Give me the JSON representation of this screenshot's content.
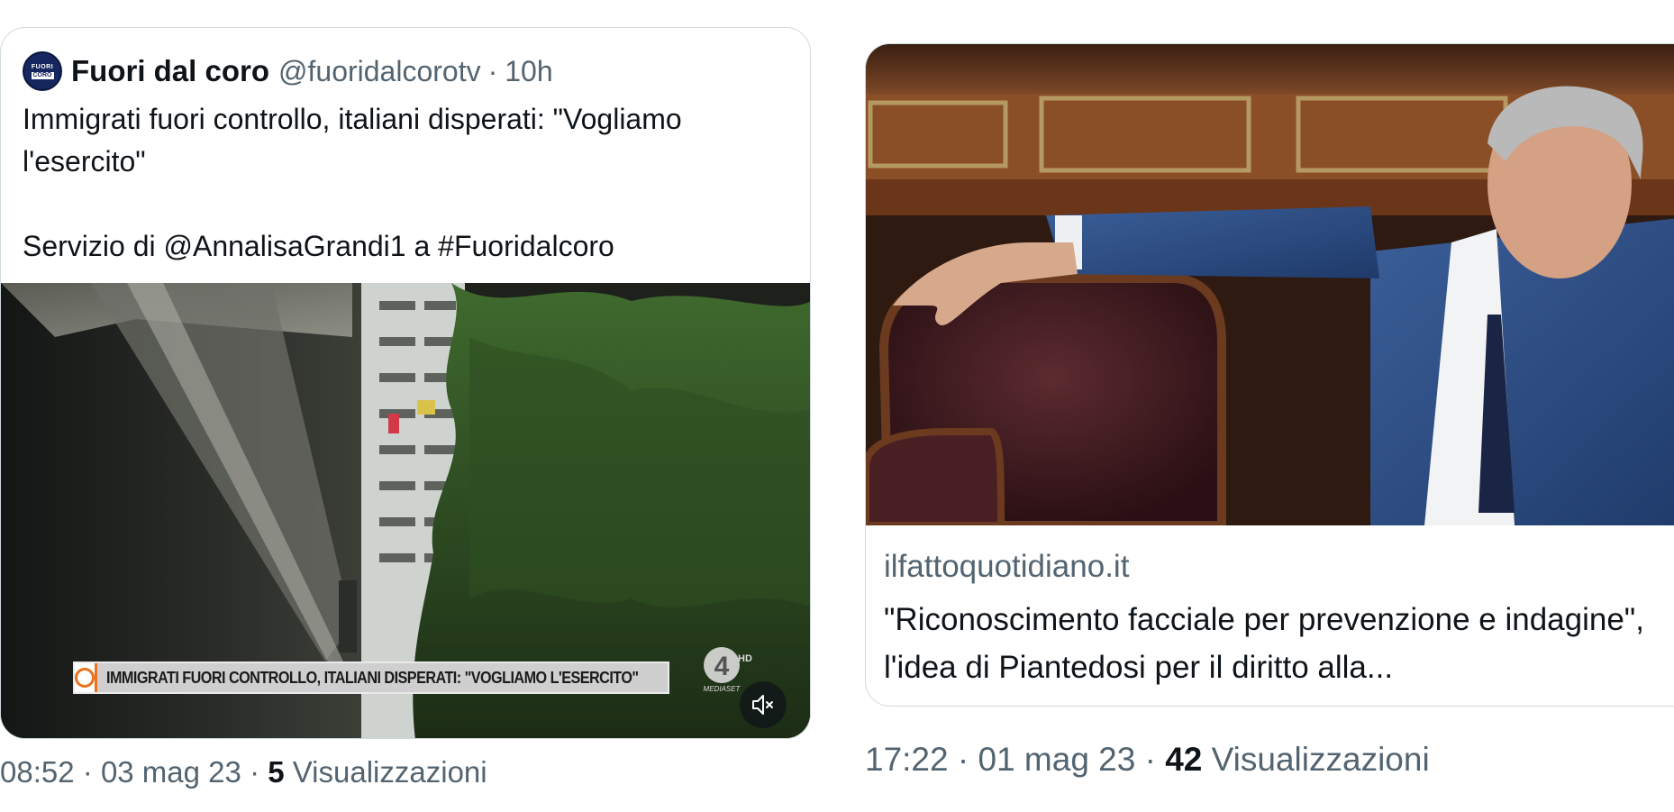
{
  "left_post": {
    "quoted_tweet": {
      "avatar_text_top": "FUORI",
      "avatar_text_bottom": "CORO",
      "author_name": "Fuori dal coro",
      "author_handle": "@fuoridalcorotv",
      "separator": "·",
      "time_ago": "10h",
      "text": "Immigrati fuori controllo, italiani disperati: \"Vogliamo l'esercito\"\n\nServizio di @AnnalisaGrandi1 a #Fuoridalcoro",
      "video": {
        "chyron_text": "IMMIGRATI FUORI CONTROLLO, ITALIANI DISPERATI: \"VOGLIAMO L'ESERCITO\"",
        "channel_number": "4",
        "channel_hd": "HD",
        "channel_name": "MEDIASET",
        "muted": true
      }
    },
    "meta": {
      "time": "08:52",
      "sep1": "·",
      "date": "03 mag 23",
      "sep2": "·",
      "views_count": "5",
      "views_label": "Visualizzazioni"
    }
  },
  "right_post": {
    "link_card": {
      "domain": "ilfattoquotidiano.it",
      "title": "\"Riconoscimento facciale per prevenzione e indagine\", l'idea di Piantedosi per il diritto alla..."
    },
    "meta": {
      "time": "17:22",
      "sep1": "·",
      "date": "01 mag 23",
      "sep2": "·",
      "views_count": "42",
      "views_label": "Visualizzazioni"
    }
  }
}
